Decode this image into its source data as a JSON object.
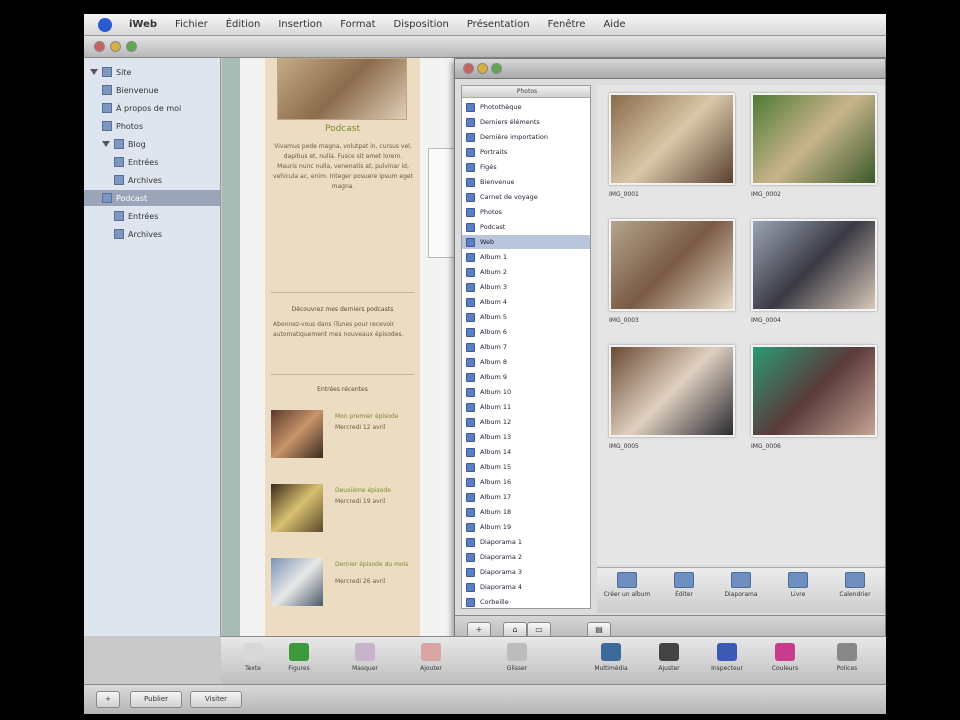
{
  "menubar": {
    "items": [
      "iWeb",
      "Fichier",
      "Édition",
      "Insertion",
      "Format",
      "Disposition",
      "Présentation",
      "Fenêtre",
      "Aide"
    ]
  },
  "sidebar": {
    "items": [
      {
        "label": "Site",
        "level": 0,
        "expanded": true
      },
      {
        "label": "Bienvenue",
        "level": 1
      },
      {
        "label": "À propos de moi",
        "level": 1
      },
      {
        "label": "Photos",
        "level": 1
      },
      {
        "label": "Blog",
        "level": 1,
        "expanded": true
      },
      {
        "label": "Entrées",
        "level": 2
      },
      {
        "label": "Archives",
        "level": 2
      },
      {
        "label": "Podcast",
        "level": 1,
        "selected": true
      },
      {
        "label": "Entrées",
        "level": 2
      },
      {
        "label": "Archives",
        "level": 2
      }
    ]
  },
  "webpage": {
    "title": "Podcast",
    "intro": "Vivamus pede magna, volutpat in, cursus vel, dapibus et, nulla. Fusce sit amet lorem. Mauris nunc nulla, venenatis at, pulvinar id, vehicula ac, enim. Integer posuere ipsum eget magna.",
    "section1_heading": "Découvrez mes derniers podcasts",
    "section1_text": "Abonnez-vous dans iTunes pour recevoir automatiquement mes nouveaux épisodes.",
    "section2_heading": "Entrées récentes",
    "entries": [
      {
        "title": "Mon premier épisode",
        "subtitle": "Mercredi 12 avril"
      },
      {
        "title": "Deuxième épisode",
        "subtitle": "Mercredi 19 avril"
      },
      {
        "title": "Dernier épisode du mois",
        "subtitle": "Mercredi 26 avril"
      }
    ]
  },
  "gallery": {
    "source_header": "Photos",
    "sources": [
      "Photothèque",
      "Derniers éléments",
      "Dernière importation",
      "Portraits",
      "Figés",
      "Bienvenue",
      "Carnet de voyage",
      "Photos",
      "Podcast",
      "Web",
      "Album 1",
      "Album 2",
      "Album 3",
      "Album 4",
      "Album 5",
      "Album 6",
      "Album 7",
      "Album 8",
      "Album 9",
      "Album 10",
      "Album 11",
      "Album 12",
      "Album 13",
      "Album 14",
      "Album 15",
      "Album 16",
      "Album 17",
      "Album 18",
      "Album 19",
      "Diaporama 1",
      "Diaporama 2",
      "Diaporama 3",
      "Diaporama 4",
      "Corbeille"
    ],
    "selected_source_index": 9,
    "photos": [
      {
        "caption": "IMG_0001",
        "colors": [
          "#8a6a4a",
          "#d8c8a8",
          "#5a4030"
        ]
      },
      {
        "caption": "IMG_0002",
        "colors": [
          "#4f7a34",
          "#c8b48c",
          "#3a5a2a"
        ]
      },
      {
        "caption": "IMG_0003",
        "colors": [
          "#b4a48c",
          "#7a5a44",
          "#e8dcc8"
        ]
      },
      {
        "caption": "IMG_0004",
        "colors": [
          "#9aa4b4",
          "#3a3a44",
          "#d8c8b8"
        ]
      },
      {
        "caption": "IMG_0005",
        "colors": [
          "#6a4a34",
          "#e0d0c0",
          "#2a2a30"
        ]
      },
      {
        "caption": "IMG_0006",
        "colors": [
          "#2a9a74",
          "#5a3a3a",
          "#c4a494"
        ]
      }
    ],
    "toolbar": [
      "Créer un album",
      "Éditer",
      "Diaporama",
      "Livre",
      "Calendrier"
    ],
    "bottom_buttons": [
      "+",
      "⌂",
      "▭",
      "▤"
    ]
  },
  "main_toolbar": [
    {
      "label": "Texte",
      "color": "#d8d8d8"
    },
    {
      "label": "Figures",
      "color": "#3c9a3c"
    },
    {
      "label": "Masquer",
      "color": "#c8b4c8"
    },
    {
      "label": "Ajouter",
      "color": "#d8a4a4"
    },
    {
      "label": "Glisser",
      "color": "#bcbcbc"
    },
    {
      "label": "Multimédia",
      "color": "#3c6a9a"
    },
    {
      "label": "Ajuster",
      "color": "#444444"
    },
    {
      "label": "Inspecteur",
      "color": "#3c5ab4"
    },
    {
      "label": "Couleurs",
      "color": "#c83c8c"
    },
    {
      "label": "Polices",
      "color": "#888888"
    }
  ],
  "status_buttons": [
    "+",
    "Publier",
    "Visiter"
  ]
}
